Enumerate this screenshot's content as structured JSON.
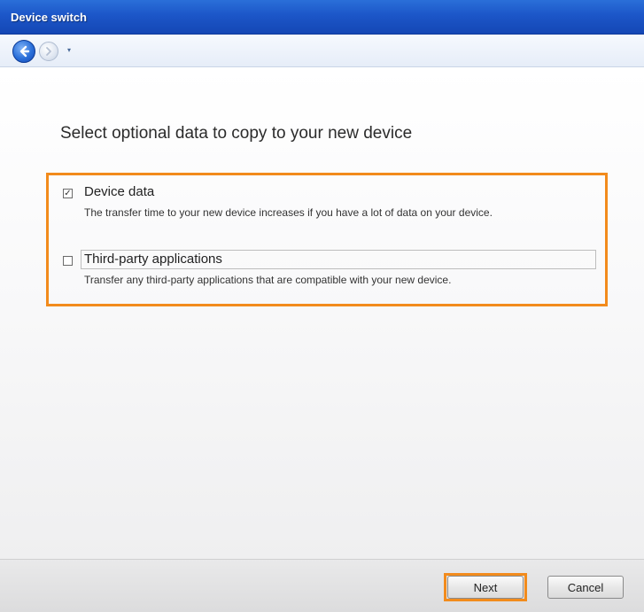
{
  "window": {
    "title": "Device switch"
  },
  "nav": {
    "back_icon": "back-arrow-icon",
    "forward_icon": "forward-arrow-icon",
    "dropdown_icon": "chevron-down-icon"
  },
  "main": {
    "heading": "Select optional data to copy to your new device",
    "options": [
      {
        "label": "Device data",
        "description": "The transfer time to your new device increases if you have a lot of data on your device.",
        "checked": true
      },
      {
        "label": "Third-party applications",
        "description": "Transfer any third-party applications that are compatible with your new device.",
        "checked": false
      }
    ]
  },
  "footer": {
    "next_label": "Next",
    "cancel_label": "Cancel"
  },
  "colors": {
    "titlebar": "#1c56c8",
    "highlight": "#f28b1c"
  }
}
